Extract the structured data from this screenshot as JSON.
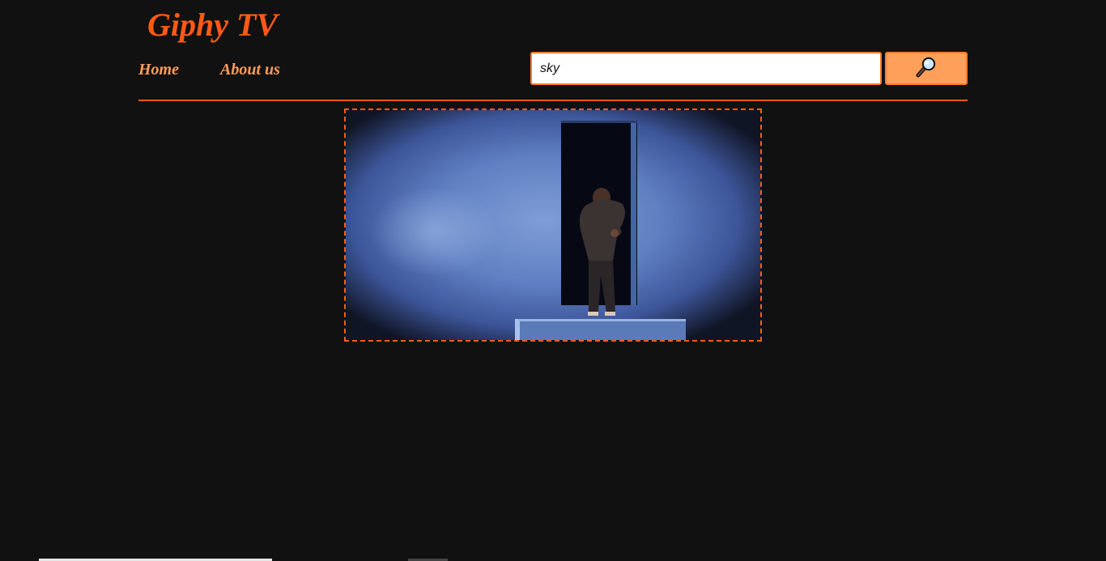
{
  "header": {
    "logo_text": "Giphy TV"
  },
  "nav": {
    "items": [
      {
        "label": "Home"
      },
      {
        "label": "About us"
      }
    ]
  },
  "search": {
    "value": "sky",
    "button_icon": "magnifier-icon"
  },
  "result": {
    "type": "animated-gif",
    "subject": "man-bending-out-of-doorway-on-blue-stage"
  },
  "colors": {
    "background": "#111111",
    "accent": "#ff5a14",
    "nav_link": "#ff9c5a",
    "search_button": "#ffa05a",
    "search_border": "#ff7a2e"
  }
}
